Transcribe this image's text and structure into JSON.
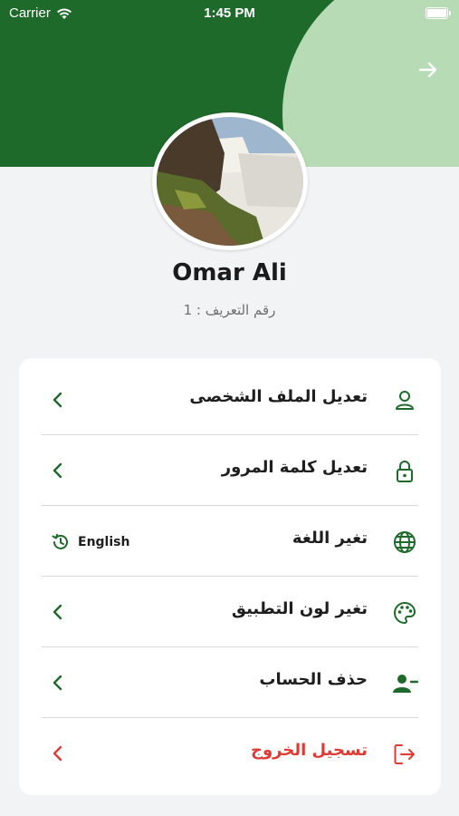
{
  "statusbar": {
    "carrier": "Carrier",
    "time": "1:45 PM"
  },
  "profile": {
    "name": "Omar Ali",
    "id_line": "رقم التعريف : 1"
  },
  "menu": [
    {
      "label": "تعديل الملف الشخصى",
      "icon": "person-icon"
    },
    {
      "label": "تعديل كلمة المرور",
      "icon": "lock-icon"
    },
    {
      "label": "تغير اللغة",
      "icon": "globe-icon",
      "value": "English"
    },
    {
      "label": "تغير لون التطبيق",
      "icon": "palette-icon"
    },
    {
      "label": "حذف الحساب",
      "icon": "person-remove-icon"
    },
    {
      "label": "تسجيل الخروج",
      "icon": "logout-icon"
    }
  ],
  "colors": {
    "primary": "#1d6a2a",
    "accent_light": "#b7dbb5",
    "danger": "#e03b33",
    "background": "#f2f3f5"
  }
}
